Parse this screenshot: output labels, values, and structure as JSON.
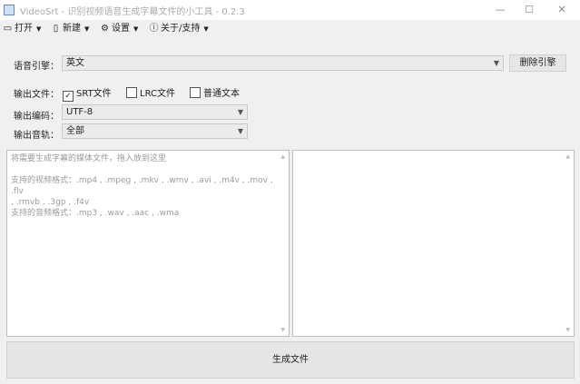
{
  "window": {
    "title": "VideoSrt - 识别视频语音生成字幕文件的小工具 - 0.2.3",
    "minimize_glyph": "—",
    "maximize_glyph": "☐",
    "close_glyph": "✕"
  },
  "menu": {
    "open": "打开",
    "new": "新建",
    "settings": "设置",
    "about": "关于/支持"
  },
  "engine": {
    "label": "语音引擎：",
    "value": "英文",
    "delete_button": "删除引擎"
  },
  "output_file": {
    "label": "输出文件：",
    "options": [
      {
        "label": "SRT文件",
        "checked": true
      },
      {
        "label": "LRC文件",
        "checked": false
      },
      {
        "label": "普通文本",
        "checked": false
      }
    ]
  },
  "encoding": {
    "label": "输出编码：",
    "value": "UTF-8"
  },
  "track": {
    "label": "输出音轨：",
    "value": "全部"
  },
  "input_area": {
    "hint": "将需要生成字幕的媒体文件，拖入放到这里\n\n支持的视频格式：.mp4 , .mpeg , .mkv , .wmv , .avi , .m4v , .mov , .flv\n, .rmvb , .3gp , .f4v\n支持的音频格式：.mp3 , .wav , .aac , .wma"
  },
  "generate_button": "生成文件"
}
